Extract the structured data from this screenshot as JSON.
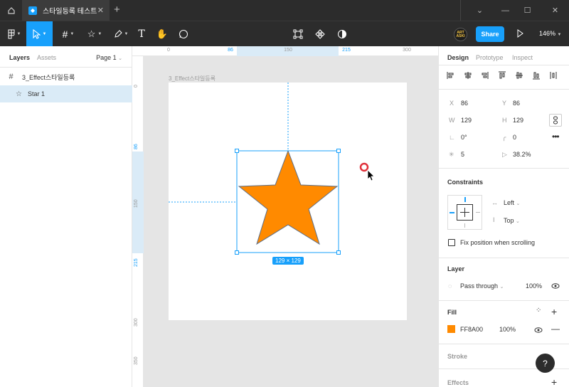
{
  "titlebar": {
    "tab_title": "스타일등록 테스트",
    "new_tab": "+"
  },
  "toolbar": {
    "share_label": "Share",
    "zoom": "146%",
    "avatar_text": "ART ASKI"
  },
  "left_panel": {
    "tabs": [
      "Layers",
      "Assets"
    ],
    "page": "Page 1",
    "layers": [
      {
        "name": "3_Effect스타일등록",
        "icon": "frame-icon"
      },
      {
        "name": "Star 1",
        "icon": "star-icon"
      }
    ]
  },
  "rulers": {
    "top": [
      "0",
      "86",
      "150",
      "215",
      "300"
    ],
    "left": [
      "0",
      "86",
      "150",
      "215",
      "300",
      "350"
    ]
  },
  "canvas": {
    "frame_label": "3_Effect스타일등록",
    "dimension_badge": "129 × 129",
    "star_fill": "#FF8A00",
    "selection_color": "#18A0FB"
  },
  "right_panel": {
    "tabs": [
      "Design",
      "Prototype",
      "Inspect"
    ],
    "x": "86",
    "y": "86",
    "w": "129",
    "h": "129",
    "rotation": "0°",
    "radius": "0",
    "points": "5",
    "ratio": "38.2%",
    "constraints_title": "Constraints",
    "constraint_h": "Left",
    "constraint_v": "Top",
    "fix_position": "Fix position when scrolling",
    "layer_title": "Layer",
    "blend_mode": "Pass through",
    "layer_opacity": "100%",
    "fill_title": "Fill",
    "fill_hex": "FF8A00",
    "fill_opacity": "100%",
    "stroke_title": "Stroke",
    "effects_title": "Effects"
  },
  "labels": {
    "x": "X",
    "y": "Y",
    "w": "W",
    "h": "H",
    "help": "?"
  }
}
